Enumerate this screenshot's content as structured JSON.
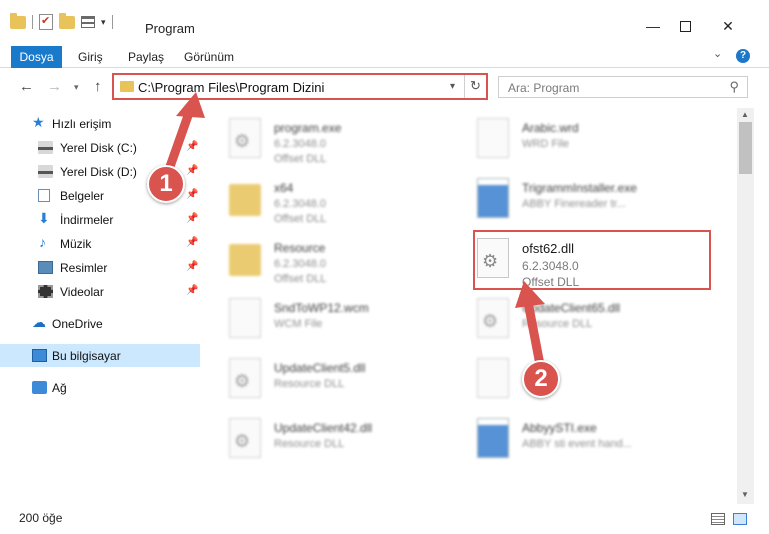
{
  "window": {
    "title": "Program",
    "minimize_glyph": "—",
    "close_glyph": "✕"
  },
  "ribbon": {
    "tabs": [
      "Dosya",
      "Giriş",
      "Paylaş",
      "Görünüm"
    ],
    "help_label": "?"
  },
  "nav": {
    "back_glyph": "←",
    "forward_glyph": "→",
    "recent_glyph": "▾",
    "up_glyph": "↑",
    "address_path": "C:\\Program Files\\Program Dizini",
    "address_dropdown_glyph": "▾",
    "refresh_glyph": "↻",
    "search_placeholder": "Ara: Program",
    "search_glyph": "⚲"
  },
  "sidebar": {
    "items": [
      {
        "label": "Hızlı erişim",
        "icon": "star-icon",
        "pinned": false
      },
      {
        "label": "Yerel Disk (C:)",
        "icon": "drive-icon",
        "pinned": true
      },
      {
        "label": "Yerel Disk (D:)",
        "icon": "drive-icon",
        "pinned": true
      },
      {
        "label": "Belgeler",
        "icon": "documents-icon",
        "pinned": true
      },
      {
        "label": "İndirmeler",
        "icon": "download-icon",
        "pinned": true
      },
      {
        "label": "Müzik",
        "icon": "music-icon",
        "pinned": true
      },
      {
        "label": "Resimler",
        "icon": "pictures-icon",
        "pinned": true
      },
      {
        "label": "Videolar",
        "icon": "videos-icon",
        "pinned": true
      },
      {
        "label": "OneDrive",
        "icon": "cloud-icon",
        "pinned": false
      },
      {
        "label": "Bu bilgisayar",
        "icon": "computer-icon",
        "pinned": false,
        "selected": true
      },
      {
        "label": "Ağ",
        "icon": "network-icon",
        "pinned": false
      }
    ],
    "pin_glyph": "📌"
  },
  "files": [
    {
      "name": "program.exe",
      "line2": "6.2.3048.0",
      "line3": "Offset DLL",
      "icon": "application-icon",
      "blurred": true
    },
    {
      "name": "Arabic.wrd",
      "line2": "WRD File",
      "line3": "",
      "icon": "blank-file-icon",
      "blurred": true
    },
    {
      "name": "x64",
      "line2": "6.2.3048.0",
      "line3": "Offset DLL",
      "icon": "folder-icon",
      "blurred": true
    },
    {
      "name": "TrigrammInstaller.exe",
      "line2": "ABBY Finereader tr...",
      "line3": "",
      "icon": "exe-icon",
      "blurred": true
    },
    {
      "name": "Resource",
      "line2": "6.2.3048.0",
      "line3": "Offset DLL",
      "icon": "folder-icon",
      "blurred": true
    },
    {
      "name": "ofst62.dll",
      "line2": "6.2.3048.0",
      "line3": "Offset DLL",
      "icon": "dll-gear-icon",
      "blurred": false,
      "highlighted": true
    },
    {
      "name": "SndToWP12.wcm",
      "line2": "WCM File",
      "line3": "",
      "icon": "blank-file-icon",
      "blurred": true
    },
    {
      "name": "UpdateClient65.dll",
      "line2": "Resource DLL",
      "line3": "",
      "icon": "dll-gear-icon",
      "blurred": true
    },
    {
      "name": "UpdateClient5.dll",
      "line2": "Resource DLL",
      "line3": "",
      "icon": "dll-gear-icon",
      "blurred": true
    },
    {
      "name": "",
      "line2": "",
      "line3": "",
      "icon": "blank-file-icon",
      "blurred": true
    },
    {
      "name": "UpdateClient42.dll",
      "line2": "Resource DLL",
      "line3": "",
      "icon": "dll-gear-icon",
      "blurred": true
    },
    {
      "name": "AbbyySTI.exe",
      "line2": "ABBY sti event hand...",
      "line3": "",
      "icon": "exe-icon",
      "blurred": true
    }
  ],
  "status": {
    "item_count": "200 öğe"
  },
  "annotations": {
    "badge1": "1",
    "badge2": "2",
    "color": "#d9534f"
  },
  "colors": {
    "accent": "#1979ca",
    "selection": "#cce8ff",
    "highlight": "#d9534f"
  }
}
